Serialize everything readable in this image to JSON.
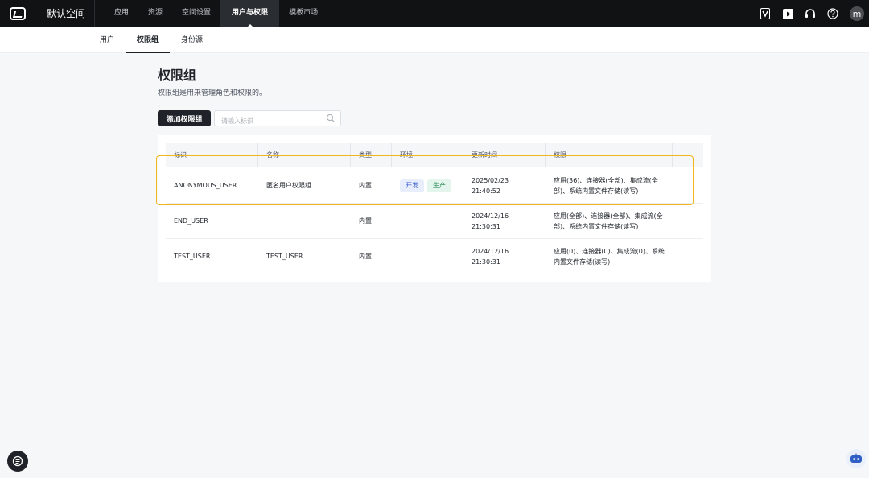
{
  "topbar": {
    "workspace": "默认空间",
    "nav": [
      "应用",
      "资源",
      "空间设置",
      "用户与权限",
      "模板市场"
    ],
    "active_nav": "用户与权限",
    "avatar_letter": "m"
  },
  "subtabs": [
    "用户",
    "权限组",
    "身份源"
  ],
  "active_subtab": "权限组",
  "page": {
    "title": "权限组",
    "description": "权限组是用来管理角色和权限的。",
    "add_button": "添加权限组",
    "search_placeholder": "请输入标识"
  },
  "table": {
    "headers": [
      "标识",
      "名称",
      "类型",
      "环境",
      "更新时间",
      "权限"
    ],
    "rows": [
      {
        "id": "ANONYMOUS_USER",
        "name": "匿名用户权限组",
        "type": "内置",
        "envs": [
          "开发",
          "生产"
        ],
        "date": "2025/02/23",
        "time": "21:40:52",
        "perm_line1": "应用(36)、连接器(全部)、集成流(全",
        "perm_line2": "部)、系统内置文件存储(读写)"
      },
      {
        "id": "END_USER",
        "name": "",
        "type": "内置",
        "envs": [],
        "date": "2024/12/16",
        "time": "21:30:31",
        "perm_line1": "应用(全部)、连接器(全部)、集成流(全",
        "perm_line2": "部)、系统内置文件存储(读写)"
      },
      {
        "id": "TEST_USER",
        "name": "TEST_USER",
        "type": "内置",
        "envs": [],
        "date": "2024/12/16",
        "time": "21:30:31",
        "perm_line1": "应用(0)、连接器(0)、集成流(0)、系统",
        "perm_line2": "内置文件存储(读写)"
      }
    ]
  },
  "colors": {
    "topbar_bg": "#101214",
    "highlight": "#f2b61b",
    "primary_button": "#1f2329",
    "tag_dev_bg": "#e8eefc",
    "tag_prod_bg": "#e3f5ec"
  },
  "icons": [
    "logo-icon",
    "vip-icon",
    "video-icon",
    "headset-icon",
    "help-icon",
    "search-icon",
    "more-icon",
    "chat-icon",
    "bot-icon"
  ]
}
